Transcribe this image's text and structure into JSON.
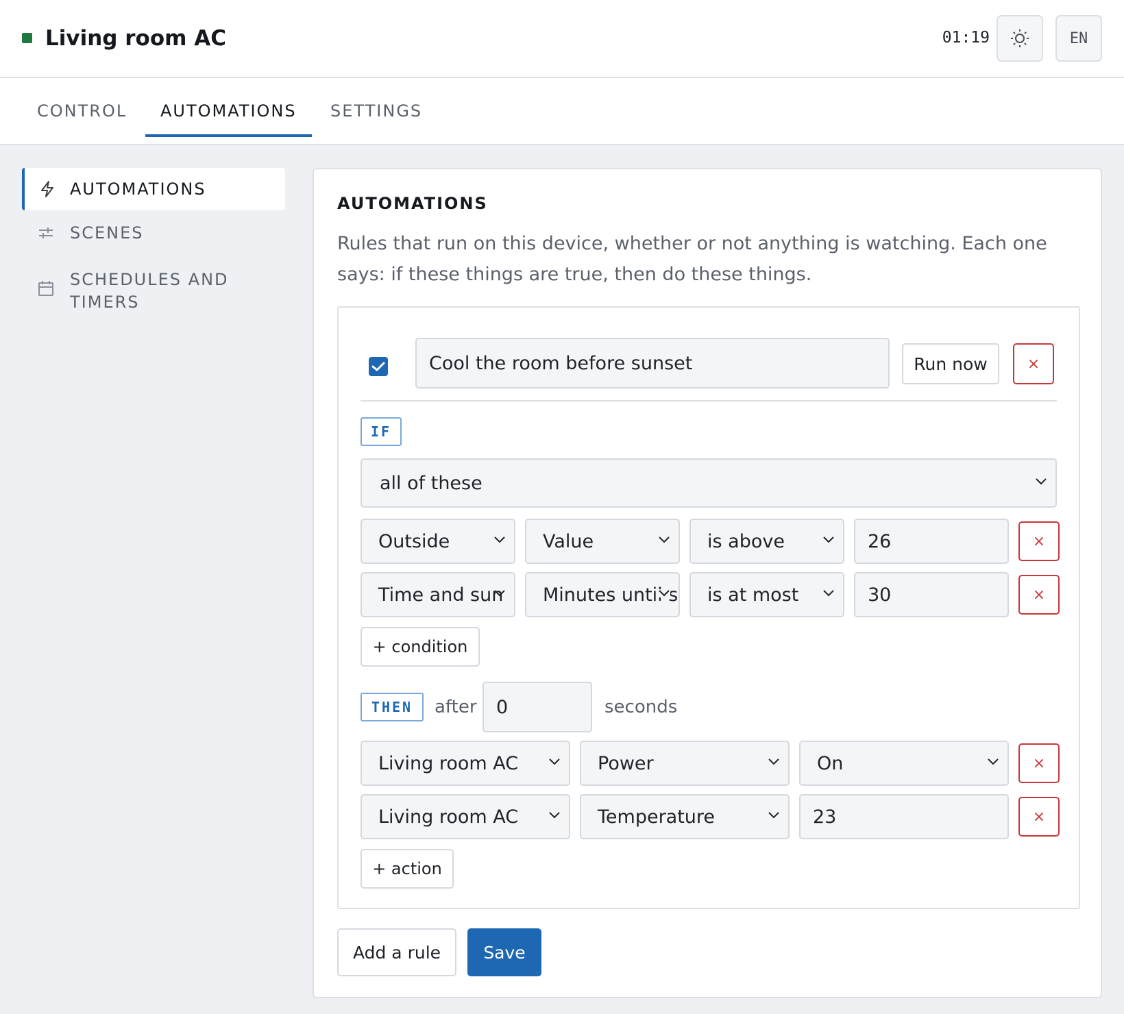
{
  "header": {
    "title": "Living room AC",
    "status_color": "#1f7a3f",
    "clock": "01:19",
    "theme_icon": "sun-icon",
    "lang": "EN"
  },
  "tabs": [
    {
      "label": "CONTROL",
      "active": false
    },
    {
      "label": "AUTOMATIONS",
      "active": true
    },
    {
      "label": "SETTINGS",
      "active": false
    }
  ],
  "sidebar": {
    "items": [
      {
        "label": "AUTOMATIONS",
        "icon": "bolt-icon",
        "active": true
      },
      {
        "label": "SCENES",
        "icon": "sliders-icon",
        "active": false
      },
      {
        "label": "SCHEDULES AND TIMERS",
        "icon": "calendar-icon",
        "active": false
      }
    ]
  },
  "panel": {
    "title": "AUTOMATIONS",
    "description": "Rules that run on this device, whether or not anything is watching. Each one says: if these things are true, then do these things."
  },
  "rule": {
    "enabled": true,
    "name": "Cool the room before sunset",
    "run_now_label": "Run now",
    "delete_label": "×",
    "if_label": "IF",
    "match_mode": "all of these",
    "conditions": [
      {
        "source": "Outside",
        "property": "Value",
        "operator": "is above",
        "value": "26"
      },
      {
        "source": "Time and sun",
        "property": "Minutes until sunset",
        "operator": "is at most",
        "value": "30"
      }
    ],
    "add_condition_label": "+ condition",
    "then_label": "THEN",
    "after_label": "after",
    "delay_value": "0",
    "seconds_label": "seconds",
    "actions": [
      {
        "device": "Living room AC",
        "property": "Power",
        "value": "On",
        "value_is_select": true
      },
      {
        "device": "Living room AC",
        "property": "Temperature",
        "value": "23",
        "value_is_select": false
      }
    ],
    "add_action_label": "+ action"
  },
  "footer": {
    "add_rule_label": "Add a rule",
    "save_label": "Save"
  },
  "colors": {
    "accent": "#1d67b3",
    "danger": "#c9373b"
  }
}
